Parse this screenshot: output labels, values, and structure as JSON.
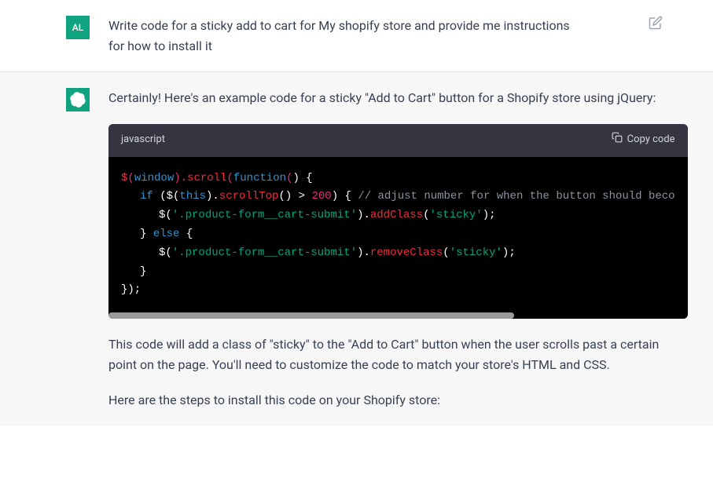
{
  "user": {
    "avatar": "AL",
    "message": "Write code for a sticky add to cart for My shopify store and provide me instructions for how to install it"
  },
  "assistant": {
    "intro": "Certainly! Here's an example code for a sticky \"Add to Cart\" button for a Shopify store using jQuery:",
    "code": {
      "language": "javascript",
      "copy_label": "Copy code",
      "tokens": {
        "l1_fn1": "$",
        "l1_p1": "(",
        "l1_var": "window",
        "l1_p2": ").",
        "l1_fn2": "scroll",
        "l1_p3": "(",
        "l1_kw": "function",
        "l1_p4": "(",
        "l1_p5": ") {",
        "l2_kw": "if",
        "l2_t1": " ($(",
        "l2_this": "this",
        "l2_t2": ").",
        "l2_fn": "scrollTop",
        "l2_t3": "() > ",
        "l2_num": "200",
        "l2_t4": ") { ",
        "l2_comment": "// adjust number for when the button should beco",
        "l3_t1": "$(",
        "l3_str": "'.product-form__cart-submit'",
        "l3_t2": ").",
        "l3_fn": "addClass",
        "l3_t3": "(",
        "l3_str2": "'sticky'",
        "l3_t4": ");",
        "l4_t1": "} ",
        "l4_kw": "else",
        "l4_t2": " {",
        "l5_t1": "$(",
        "l5_str": "'.product-form__cart-submit'",
        "l5_t2": ").",
        "l5_fn": "removeClass",
        "l5_t3": "(",
        "l5_str2": "'sticky'",
        "l5_t4": ");",
        "l6": "}",
        "l7": "});"
      }
    },
    "para1": "This code will add a class of \"sticky\" to the \"Add to Cart\" button when the user scrolls past a certain point on the page. You'll need to customize the code to match your store's HTML and CSS.",
    "para2": "Here are the steps to install this code on your Shopify store:"
  }
}
